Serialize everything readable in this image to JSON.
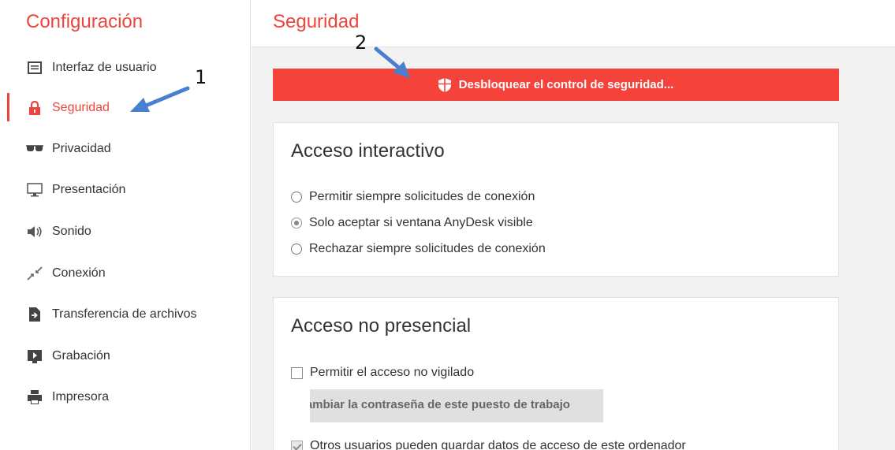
{
  "sidebar": {
    "title": "Configuración",
    "items": [
      {
        "label": "Interfaz de usuario",
        "icon": "window-icon"
      },
      {
        "label": "Seguridad",
        "icon": "lock-icon",
        "active": true
      },
      {
        "label": "Privacidad",
        "icon": "sunglasses-icon"
      },
      {
        "label": "Presentación",
        "icon": "monitor-icon"
      },
      {
        "label": "Sonido",
        "icon": "speaker-icon"
      },
      {
        "label": "Conexión",
        "icon": "connection-icon"
      },
      {
        "label": "Transferencia de archivos",
        "icon": "file-transfer-icon"
      },
      {
        "label": "Grabación",
        "icon": "recording-icon"
      },
      {
        "label": "Impresora",
        "icon": "printer-icon"
      }
    ]
  },
  "main": {
    "title": "Seguridad",
    "unlock_button": "Desbloquear el control de seguridad...",
    "interactive_access": {
      "title": "Acceso interactivo",
      "options": [
        {
          "label": "Permitir siempre solicitudes de conexión",
          "checked": false
        },
        {
          "label": "Solo aceptar si ventana AnyDesk visible",
          "checked": true
        },
        {
          "label": "Rechazar siempre solicitudes de conexión",
          "checked": false
        }
      ]
    },
    "unattended_access": {
      "title": "Acceso no presencial",
      "allow_unattended": "Permitir el acceso no vigilado",
      "change_password_button": "Cambiar la contraseña de este puesto de trabajo",
      "save_credentials": "Otros usuarios pueden guardar datos de acceso de este ordenador"
    }
  },
  "annotations": {
    "step1": "1",
    "step2": "2"
  },
  "colors": {
    "accent": "#ef443b",
    "annotation_arrow": "#4a7fd0"
  }
}
